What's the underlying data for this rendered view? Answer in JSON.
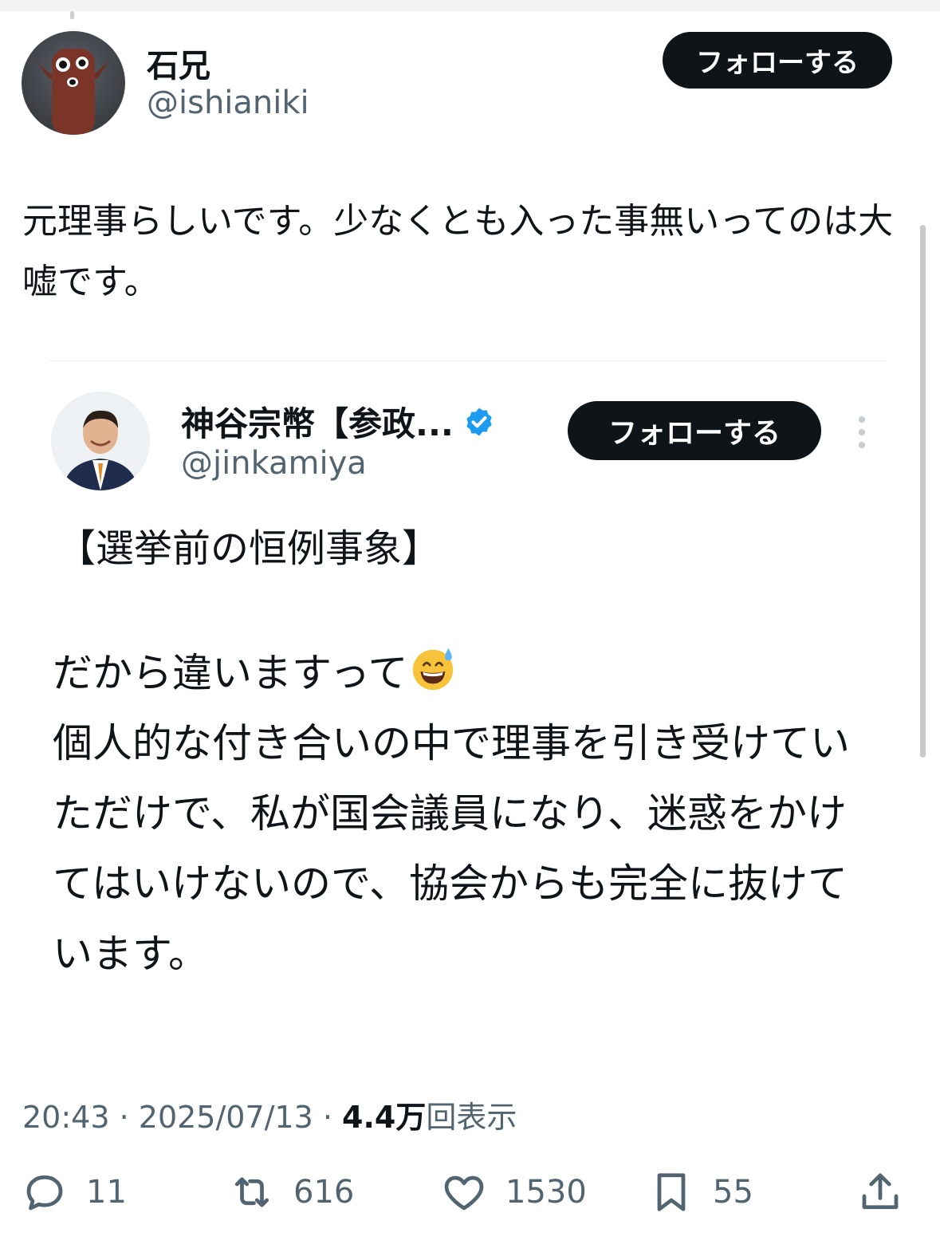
{
  "tweet": {
    "author": {
      "name": "石兄",
      "handle": "@ishianiki"
    },
    "follow_label": "フォローする",
    "text": "元理事らしいです。少なくとも入った事無いってのは大嘘です。",
    "time": "20:43",
    "date": "2025/07/13",
    "views_count": "4.4万",
    "views_label": "回表示",
    "metrics": {
      "replies": "11",
      "reposts": "616",
      "likes": "1530",
      "bookmarks": "55"
    }
  },
  "quoted": {
    "author": {
      "name": "神谷宗幣【参政...",
      "handle": "@jinkamiya",
      "verified": true
    },
    "follow_label": "フォローする",
    "title": "【選挙前の恒例事象】",
    "body_line1": "だから違いますって",
    "body_rest": "個人的な付き合いの中で理事を引き受けていただけで、私が国会議員になり、迷惑をかけてはいけないので、協会からも完全に抜けています。"
  },
  "colors": {
    "text": "#0f1419",
    "muted": "#536471",
    "button": "#0f1419",
    "verified": "#1d9bf0"
  },
  "icons": [
    "reply-icon",
    "repost-icon",
    "like-icon",
    "bookmark-icon",
    "share-icon",
    "verified-badge-icon",
    "more-options-icon",
    "sweat-smile-emoji"
  ]
}
